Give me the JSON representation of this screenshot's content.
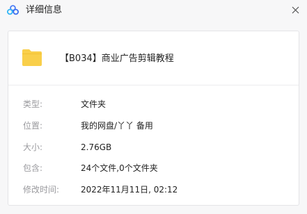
{
  "window": {
    "title": "详细信息",
    "app_icon": "baidu-netdisk-cloud-icon",
    "close_icon": "close-icon"
  },
  "file": {
    "icon": "folder-icon",
    "icon_color": "#f9cf4a",
    "name": "【B034】商业广告剪辑教程"
  },
  "details": [
    {
      "label": "类型:",
      "value": "文件夹"
    },
    {
      "label": "位置:",
      "value": "我的网盘/丫丫 备用"
    },
    {
      "label": "大小:",
      "value": "2.76GB"
    },
    {
      "label": "包含:",
      "value": "24个文件,0个文件夹"
    },
    {
      "label": "修改时间:",
      "value": "2022年11月11日, 02:12"
    }
  ]
}
